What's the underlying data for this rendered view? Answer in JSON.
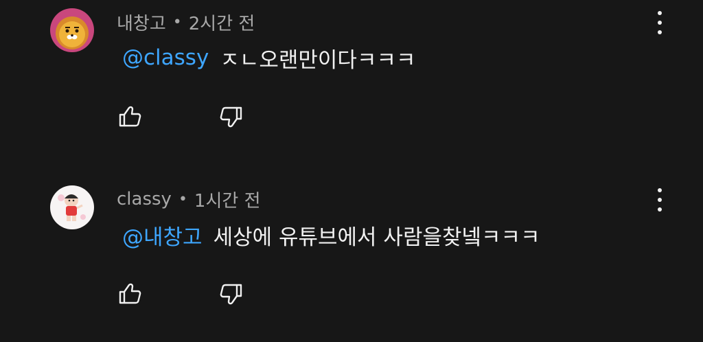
{
  "comments": [
    {
      "author": "내창고",
      "separator": "•",
      "time": "2시간 전",
      "mention": "@classy",
      "text": "ㅈㄴ오랜만이다ㅋㅋㅋ",
      "avatar_icon": "lion-character-avatar"
    },
    {
      "author": "classy",
      "separator": "•",
      "time": "1시간 전",
      "mention": "@내창고",
      "text": "세상에 유튜브에서 사람을찾넼ㅋㅋㅋ",
      "avatar_icon": "cartoon-boy-avatar"
    }
  ],
  "icons": {
    "like": "thumbs-up-icon",
    "dislike": "thumbs-down-icon",
    "more": "more-vert-icon"
  },
  "colors": {
    "background": "#171717",
    "mention": "#3ea6ff",
    "meta_text": "#a8a8a8",
    "body_text": "#f1f1f1"
  }
}
